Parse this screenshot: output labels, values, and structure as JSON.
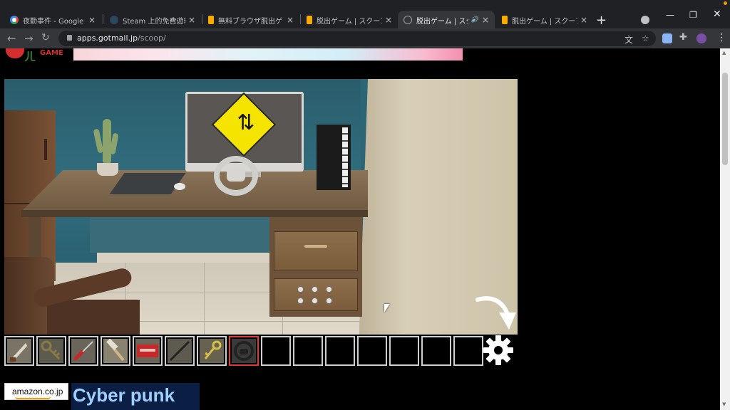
{
  "browser": {
    "tabs": [
      {
        "title": "夜勤事件 - Google 搜",
        "favicon": "google-icon"
      },
      {
        "title": "Steam 上的免費遊玩游",
        "favicon": "steam-icon"
      },
      {
        "title": "無料ブラウザ脱出ゲ",
        "favicon": "game-site-icon"
      },
      {
        "title": "脱出ゲーム | スクープ",
        "favicon": "game-site-icon"
      },
      {
        "title": "脱出ゲーム | スク",
        "favicon": "globe-icon",
        "active": true,
        "audio": true
      },
      {
        "title": "脱出ゲーム | スクープ",
        "favicon": "game-site-icon"
      }
    ],
    "url_host": "apps.gotmail.jp",
    "url_path": "/scoop/",
    "new_tab_label": "+",
    "close_label": "×"
  },
  "site": {
    "logo_text": "GAME"
  },
  "game": {
    "inventory": [
      {
        "item": "knife",
        "icon": "knife-icon"
      },
      {
        "item": "key",
        "icon": "key-icon"
      },
      {
        "item": "screwdriver",
        "icon": "screwdriver-icon"
      },
      {
        "item": "hammer",
        "icon": "hammer-icon"
      },
      {
        "item": "red card",
        "icon": "card-icon"
      },
      {
        "item": "rod",
        "icon": "rod-icon"
      },
      {
        "item": "small key",
        "icon": "small-key-icon"
      },
      {
        "item": "steering wheel",
        "icon": "steering-wheel-icon",
        "selected": true
      },
      {
        "item": "",
        "icon": ""
      },
      {
        "item": "",
        "icon": ""
      },
      {
        "item": "",
        "icon": ""
      },
      {
        "item": "",
        "icon": ""
      },
      {
        "item": "",
        "icon": ""
      },
      {
        "item": "",
        "icon": ""
      },
      {
        "item": "",
        "icon": ""
      }
    ],
    "colors": {
      "selected_slot": "#e53935",
      "slot_border": "#cfcfcf",
      "sign_yellow": "#f5e400"
    }
  },
  "ads": {
    "amazon_label": "amazon.co.jp",
    "cyber_label": "Cyber punk"
  }
}
